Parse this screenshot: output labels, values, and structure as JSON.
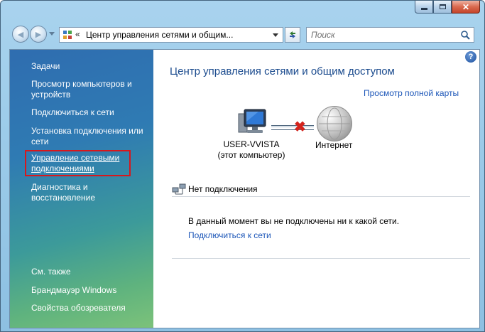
{
  "window": {
    "caption_buttons": {
      "minimize": "minimize-icon",
      "maximize": "maximize-icon",
      "close": "close-icon"
    }
  },
  "navbar": {
    "address_chevron": "«",
    "address_text": "Центр управления сетями и общим...",
    "search_placeholder": "Поиск"
  },
  "sidebar": {
    "tasks_header": "Задачи",
    "items": [
      {
        "label": "Просмотр компьютеров и устройств"
      },
      {
        "label": "Подключиться к сети"
      },
      {
        "label": "Установка подключения или сети"
      },
      {
        "label": "Управление сетевыми подключениями"
      },
      {
        "label": "Диагностика и восстановление"
      }
    ],
    "see_also_header": "См. также",
    "see_also": [
      {
        "label": "Брандмауэр Windows"
      },
      {
        "label": "Свойства обозревателя"
      }
    ]
  },
  "main": {
    "help": "?",
    "title": "Центр управления сетями и общим доступом",
    "full_map_link": "Просмотр полной карты",
    "computer_name": "USER-VVISTA",
    "computer_sub": "(этот компьютер)",
    "internet_label": "Интернет",
    "section_title": "Нет подключения",
    "status_text": "В данный момент вы не подключены ни к какой сети.",
    "connect_link": "Подключиться к сети"
  },
  "colors": {
    "title": "#1b4b8e",
    "link": "#1c56b8",
    "highlight": "#d8171c",
    "disconnected": "#d3231d"
  }
}
